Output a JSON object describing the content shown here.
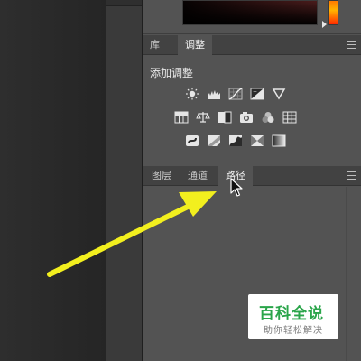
{
  "adjustments_panel": {
    "tabs": [
      {
        "label": "库",
        "active": false
      },
      {
        "label": "调整",
        "active": true
      }
    ],
    "title": "添加调整",
    "icon_rows": [
      [
        "brightness-contrast-icon",
        "levels-icon",
        "curves-icon",
        "exposure-icon",
        "vibrance-icon"
      ],
      [
        "hue-saturation-icon",
        "color-balance-icon",
        "black-white-icon",
        "photo-filter-icon",
        "channel-mixer-icon",
        "color-lookup-icon"
      ],
      [
        "invert-icon",
        "posterize-icon",
        "threshold-icon",
        "selective-color-icon",
        "gradient-map-icon"
      ]
    ]
  },
  "layers_panel": {
    "tabs": [
      {
        "label": "图层",
        "active": false
      },
      {
        "label": "通道",
        "active": false
      },
      {
        "label": "路径",
        "active": true
      }
    ]
  },
  "colors": {
    "panel_bg": "#535353",
    "tab_strip_bg": "#424242",
    "arrow": "#f2ef1e",
    "watermark_brand": "#2aa54a"
  },
  "watermark": {
    "title": "百科全说",
    "subtitle": "助你轻松解决"
  }
}
